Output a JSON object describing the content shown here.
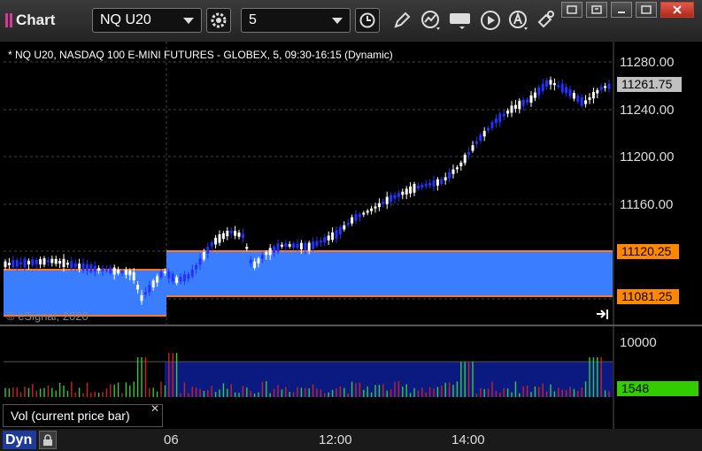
{
  "app": {
    "title": "Chart"
  },
  "toolbar": {
    "symbol": "NQ U20",
    "interval": "5"
  },
  "chart": {
    "description": "* NQ U20, NASDAQ 100 E-MINI FUTURES - GLOBEX, 5, 09:30-16:15 (Dynamic)",
    "copyright": "© eSignal, 2020",
    "price_ticks": [
      "11280.00",
      "11240.00",
      "11200.00",
      "11160.00"
    ],
    "price_tags": {
      "last": "11261.75",
      "upper": "11120.25",
      "lower": "11081.25"
    },
    "volume_ticks": {
      "top": "10000",
      "current": "1548"
    },
    "time_ticks": [
      "06",
      "12:00",
      "14:00"
    ],
    "volume_study_label": "Vol (current price bar)",
    "colors": {
      "up_candle": "#ffffff",
      "down_candle": "#2233ff",
      "zone": "#3a7dff",
      "zone_border": "#ff7722",
      "last_tag": "#c0c0c0",
      "level_tag": "#ff8800",
      "volume_tag": "#33cc00",
      "vol_up": "#33cc33",
      "vol_down": "#cc2222"
    }
  },
  "bottom": {
    "layout_label": "Dyn"
  }
}
